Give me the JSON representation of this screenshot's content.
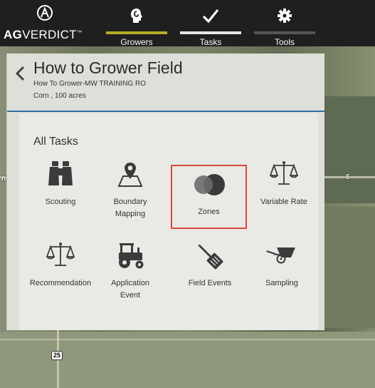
{
  "app": {
    "brand_bold": "AG",
    "brand_rest": "VERDICT",
    "brand_mark": "™"
  },
  "nav": {
    "tabs": [
      {
        "label": "Growers",
        "icon": "grower-head-icon",
        "bar_color": "#b5ad2a"
      },
      {
        "label": "Tasks",
        "icon": "checkmark-icon",
        "bar_color": "#e6e6e6"
      },
      {
        "label": "Tools",
        "icon": "gear-icon",
        "bar_color": "#555555"
      }
    ]
  },
  "field": {
    "title": "How to Grower Field",
    "subtitle": "How To Grower-MW TRAINING RO",
    "details": "Corn , 100 acres"
  },
  "tasks": {
    "heading": "All Tasks",
    "items": [
      {
        "label": "Scouting",
        "icon": "binoculars-icon"
      },
      {
        "label": "Boundary Mapping",
        "icon": "map-pin-icon"
      },
      {
        "label": "Zones",
        "icon": "zones-circles-icon",
        "selected": true
      },
      {
        "label": "Variable Rate",
        "icon": "scale-icon"
      },
      {
        "label": "Recommendation",
        "icon": "scale-icon"
      },
      {
        "label": "Application Event",
        "icon": "tractor-icon"
      },
      {
        "label": "Field Events",
        "icon": "spatula-icon"
      },
      {
        "label": "Sampling",
        "icon": "wheelbarrow-icon"
      }
    ]
  },
  "map": {
    "label_left": "nd S",
    "label_right": "6",
    "road_shield": "25"
  },
  "colors": {
    "topbar": "#1f1f1f",
    "panel": "#dedfd9",
    "tasks_body": "#e9e9e6",
    "divider": "#2f6ea1",
    "highlight": "#d9493c",
    "icon": "#3b3b3b"
  }
}
